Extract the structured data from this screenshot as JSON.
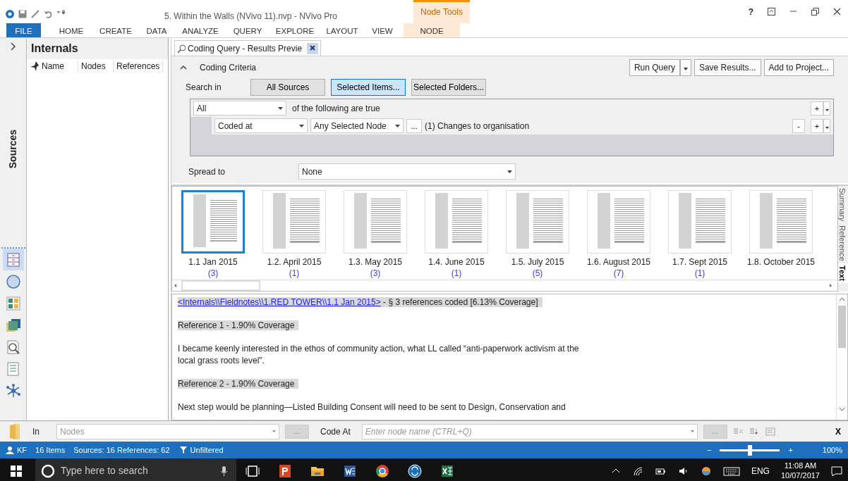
{
  "window": {
    "title": "5. Within the Walls (NVivo 11).nvp - NVivo Pro",
    "context_group": "Node Tools",
    "help": "?"
  },
  "ribbon_tabs": [
    {
      "label": "FILE",
      "kind": "file"
    },
    {
      "label": "HOME",
      "kind": "normal"
    },
    {
      "label": "CREATE",
      "kind": "normal"
    },
    {
      "label": "DATA",
      "kind": "normal"
    },
    {
      "label": "ANALYZE",
      "kind": "normal"
    },
    {
      "label": "QUERY",
      "kind": "normal"
    },
    {
      "label": "EXPLORE",
      "kind": "normal"
    },
    {
      "label": "LAYOUT",
      "kind": "normal"
    },
    {
      "label": "VIEW",
      "kind": "normal"
    },
    {
      "label": "NODE",
      "kind": "context"
    }
  ],
  "navigation": {
    "title": "Sources",
    "buttons": [
      {
        "kind": "sources",
        "selected": true
      },
      {
        "kind": "nodes",
        "selected": false
      },
      {
        "kind": "classifications",
        "selected": false
      },
      {
        "kind": "collections",
        "selected": false
      },
      {
        "kind": "queries",
        "selected": false
      },
      {
        "kind": "reports",
        "selected": false
      },
      {
        "kind": "maps",
        "selected": false
      }
    ]
  },
  "list_panel": {
    "title": "Internals",
    "columns": [
      "Name",
      "Nodes",
      "References"
    ]
  },
  "document_tab": {
    "title": "Coding Query - Results Previe"
  },
  "criteria": {
    "title": "Coding Criteria",
    "expanded": true,
    "buttons": [
      "Run Query",
      "Save Results...",
      "Add to Project..."
    ],
    "search_in_label": "Search in",
    "search_in": [
      {
        "label": "All Sources",
        "selected": false
      },
      {
        "label": "Selected Items...",
        "selected": true
      },
      {
        "label": "Selected Folders...",
        "selected": false
      }
    ],
    "match": "All",
    "match_text": "of the following are true",
    "condition": {
      "field": "Coded at",
      "scope": "Any Selected Node",
      "browse": "...",
      "value": "(1) Changes to organisation"
    },
    "add": "+",
    "remove": "-",
    "spread_label": "Spread to",
    "spread": "None"
  },
  "thumbnails": [
    {
      "label": "1.1 Jan 2015",
      "count": "(3)",
      "selected": true
    },
    {
      "label": "1.2. April 2015",
      "count": "(1)",
      "selected": false
    },
    {
      "label": "1.3. May 2015",
      "count": "(3)",
      "selected": false
    },
    {
      "label": "1.4. June 2015",
      "count": "(1)",
      "selected": false
    },
    {
      "label": "1.5. July 2015",
      "count": "(5)",
      "selected": false
    },
    {
      "label": "1.6. August 2015",
      "count": "(7)",
      "selected": false
    },
    {
      "label": "1.7. Sept 2015",
      "count": "(1)",
      "selected": false
    },
    {
      "label": "1.8. October 2015",
      "selected": false
    }
  ],
  "side_tabs": [
    {
      "label": "Summary",
      "selected": false
    },
    {
      "label": "Reference",
      "selected": false
    },
    {
      "label": "Text",
      "selected": true
    }
  ],
  "results": {
    "link": "<Internals\\\\Fieldnotes\\\\1.RED TOWER\\\\1.1 Jan 2015>",
    "summary": "- § 3 references coded  [6.13% Coverage]",
    "blocks": [
      {
        "kind": "heading",
        "text": "Reference 1 - 1.90% Coverage"
      },
      {
        "kind": "paragraph",
        "text": "I became keenly interested in the ethos of community action, what LL called “anti-paperwork activism at the local grass roots level”."
      },
      {
        "kind": "heading",
        "text": "Reference 2 - 1.90% Coverage"
      },
      {
        "kind": "paragraph",
        "text": "Next step would be planning—Listed Building Consent will need to be sent to Design, Conservation and"
      }
    ]
  },
  "coding_bar": {
    "in_label": "In",
    "in_placeholder": "Nodes",
    "browse": "...",
    "code_at_label": "Code At",
    "node_placeholder": "Enter node name (CTRL+Q)",
    "browse_node": "...",
    "close": "X"
  },
  "status_bar": {
    "user": "KF",
    "items": "16 Items",
    "counts": "Sources: 16  References: 62",
    "filter": "Unfiltered",
    "zoom_out": "−",
    "zoom_in": "+",
    "level": 0.5,
    "zoom": "100%"
  },
  "taskbar": {
    "search_placeholder": "Type here to search",
    "language": "ENG",
    "time": "11:08 AM",
    "date": "10/07/2017"
  }
}
